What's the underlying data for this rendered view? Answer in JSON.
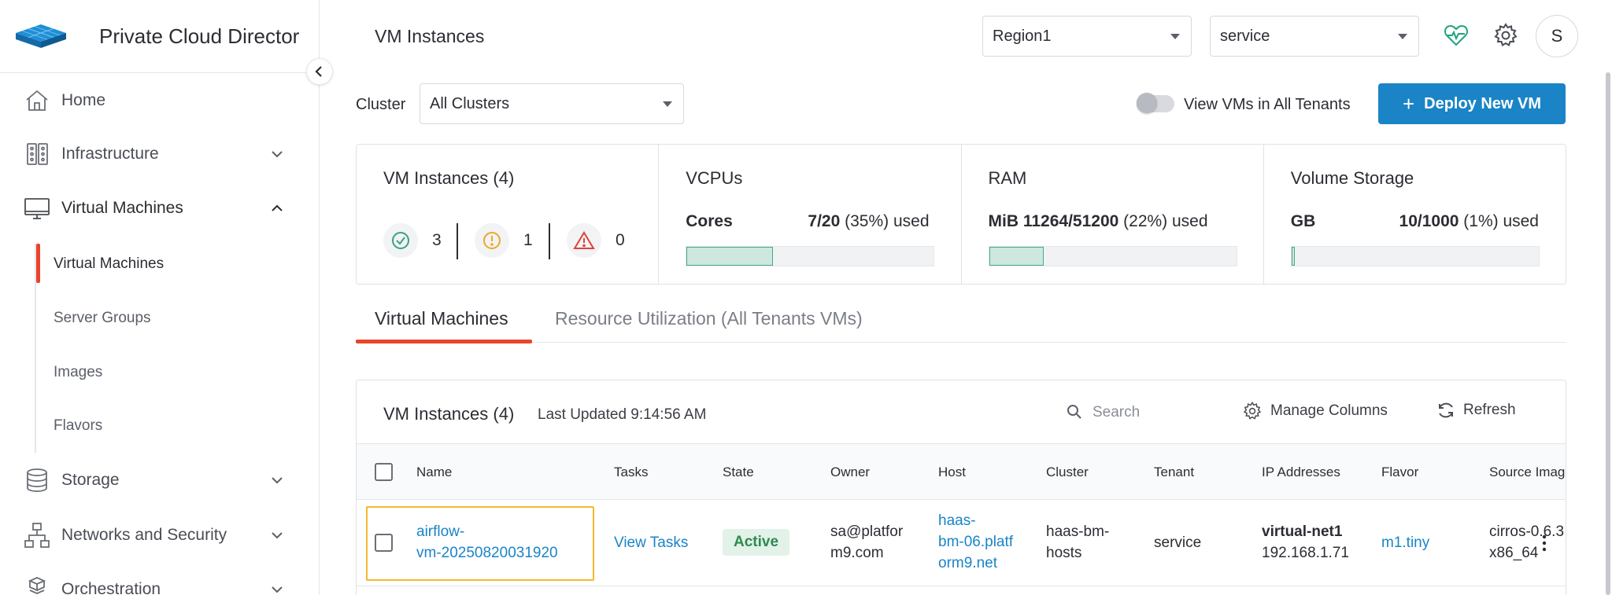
{
  "app": {
    "title": "Private Cloud Director",
    "page_title": "VM Instances"
  },
  "sidebar": {
    "items": [
      {
        "label": "Home",
        "icon": "home-icon"
      },
      {
        "label": "Infrastructure",
        "icon": "infrastructure-icon"
      },
      {
        "label": "Virtual Machines",
        "icon": "monitor-icon"
      },
      {
        "label": "Storage",
        "icon": "database-icon"
      },
      {
        "label": "Networks and Security",
        "icon": "network-icon"
      },
      {
        "label": "Orchestration",
        "icon": "cubes-icon"
      }
    ],
    "sub_items": [
      "Virtual Machines",
      "Server Groups",
      "Images",
      "Flavors"
    ],
    "active_sub_item": "Virtual Machines",
    "accent_color": "#e8452c"
  },
  "header": {
    "region": "Region1",
    "tenant": "service",
    "avatar_initial": "S"
  },
  "filters": {
    "cluster_label": "Cluster",
    "cluster_value": "All Clusters",
    "toggle_label": "View VMs in All Tenants",
    "toggle_on": false,
    "deploy_label": "Deploy New VM"
  },
  "stats": {
    "vm_instances": {
      "title": "VM Instances (4)",
      "ok": "3",
      "warning": "1",
      "error": "0"
    },
    "vcpus": {
      "title": "VCPUs",
      "unit": "Cores",
      "used": "7/20",
      "pct": "(35%) used",
      "fraction": 0.35
    },
    "ram": {
      "title": "RAM",
      "unit": "MiB",
      "used": "11264/51200",
      "pct": "(22%) used",
      "fraction": 0.22
    },
    "storage": {
      "title": "Volume Storage",
      "unit": "GB",
      "used": "10/1000",
      "pct": "(1%) used",
      "fraction": 0.01
    }
  },
  "tabs": [
    {
      "label": "Virtual Machines",
      "active": true
    },
    {
      "label": "Resource Utilization (All Tenants VMs)",
      "active": false
    }
  ],
  "table": {
    "title": "VM Instances (4)",
    "last_updated": "Last Updated 9:14:56 AM",
    "search_placeholder": "Search",
    "manage_columns": "Manage Columns",
    "refresh": "Refresh",
    "columns": [
      "Name",
      "Tasks",
      "State",
      "Owner",
      "Host",
      "Cluster",
      "Tenant",
      "IP Addresses",
      "Flavor",
      "Source Imag"
    ],
    "rows": [
      {
        "name_1": "airflow-",
        "name_2": "vm-20250820031920",
        "tasks": "View Tasks",
        "state": "Active",
        "owner_1": "sa@platfor",
        "owner_2": "m9.com",
        "host_1": "haas-",
        "host_2": "bm-06.platf",
        "host_3": "orm9.net",
        "cluster_1": "haas-bm-",
        "cluster_2": "hosts",
        "tenant": "service",
        "ip_net": "virtual-net1",
        "ip_addr": "192.168.1.71",
        "flavor": "m1.tiny",
        "source_1": "cirros-0.6.3",
        "source_2": "x86_64"
      }
    ]
  },
  "colors": {
    "primary": "#1a84c7",
    "active_green": "#2e8a4f",
    "highlight": "#f5b82e"
  }
}
